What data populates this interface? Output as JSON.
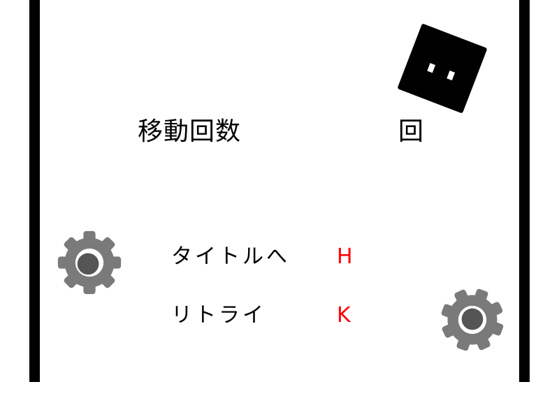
{
  "hud": {
    "moves_label": "移動回数",
    "moves_unit": "回"
  },
  "menu": {
    "items": [
      {
        "label": "タイトルへ",
        "key": "H"
      },
      {
        "label": "リトライ",
        "key": "K"
      }
    ]
  },
  "icons": {
    "player": "black-square-character-icon",
    "gear": "gear-icon"
  },
  "colors": {
    "background": "#ffffff",
    "border": "#000000",
    "key_hint": "#ff0000",
    "gear": "#7a7a7a",
    "gear_core": "#555555"
  }
}
